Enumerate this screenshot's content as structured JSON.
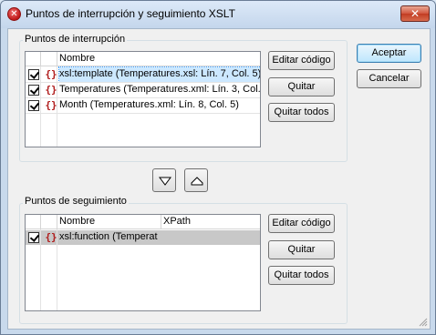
{
  "window": {
    "title": "Puntos de interrupción y seguimiento XSLT",
    "close_glyph": "✕",
    "app_icon_glyph": "✕"
  },
  "breakpoints": {
    "group_label": "Puntos de interrupción",
    "columns": [
      "Nombre"
    ],
    "rows": [
      {
        "checked": true,
        "icon": "{}",
        "text": "xsl:template  (Temperatures.xsl: Lín. 7, Col. 5)",
        "selected": true
      },
      {
        "checked": true,
        "icon": "{}",
        "text": "Temperatures  (Temperatures.xml: Lín. 3, Col.",
        "selected": false
      },
      {
        "checked": true,
        "icon": "{}",
        "text": "Month  (Temperatures.xml: Lín. 8, Col. 5)",
        "selected": false
      }
    ],
    "buttons": {
      "edit": "Editar código",
      "remove": "Quitar",
      "remove_all": "Quitar todos"
    }
  },
  "move_buttons": {
    "down": "move-down",
    "up": "move-up"
  },
  "tracepoints": {
    "group_label": "Puntos de seguimiento",
    "columns": [
      "Nombre",
      "XPath"
    ],
    "rows": [
      {
        "checked": true,
        "icon": "{}",
        "text": "xsl:function  (Temperat",
        "selected": true
      }
    ],
    "buttons": {
      "edit": "Editar código",
      "remove": "Quitar",
      "remove_all": "Quitar todos"
    }
  },
  "dialog_buttons": {
    "ok": "Aceptar",
    "cancel": "Cancelar"
  },
  "colors": {
    "accent_border": "#3c7fb1",
    "breakpoint_icon": "#b01c1c",
    "selected_row": "#cce8ff",
    "gray_row": "#c8c8c8"
  }
}
